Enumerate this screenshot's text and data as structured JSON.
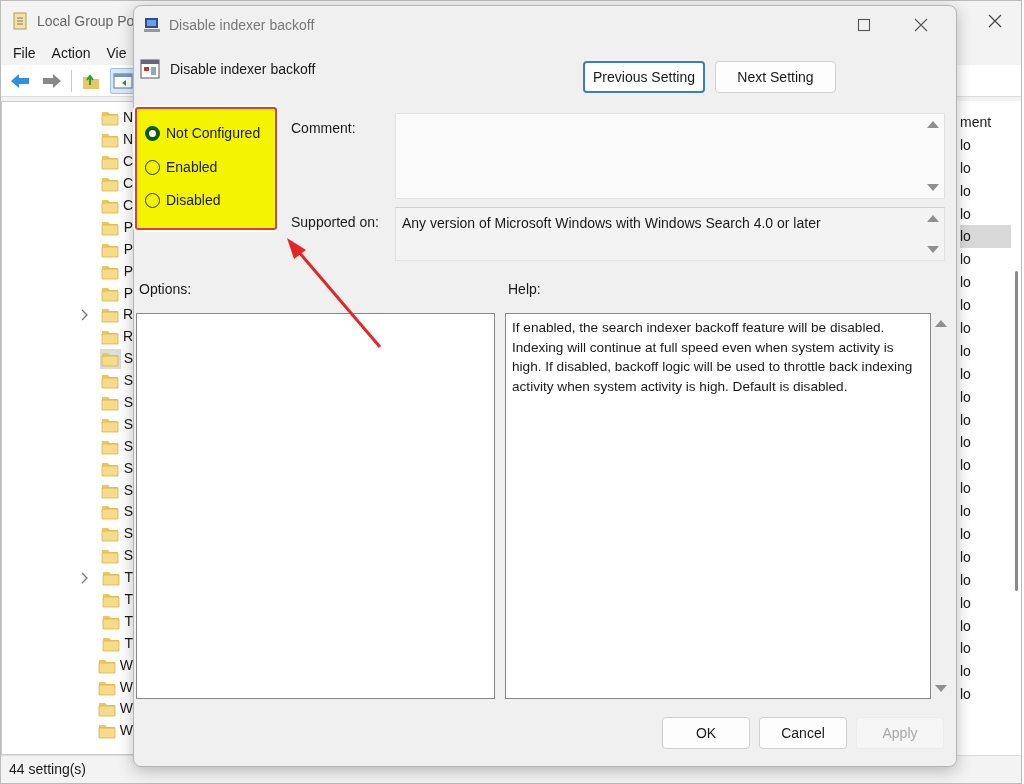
{
  "background_window": {
    "title": "Local Group Po",
    "menu": [
      "File",
      "Action",
      "Vie"
    ],
    "tree": [
      {
        "label": "N",
        "expandable": false,
        "selected": false
      },
      {
        "label": "N",
        "expandable": false,
        "selected": false
      },
      {
        "label": "C",
        "expandable": false,
        "selected": false
      },
      {
        "label": "C",
        "expandable": false,
        "selected": false
      },
      {
        "label": "C",
        "expandable": false,
        "selected": false
      },
      {
        "label": "P",
        "expandable": false,
        "selected": false
      },
      {
        "label": "P",
        "expandable": false,
        "selected": false
      },
      {
        "label": "P",
        "expandable": false,
        "selected": false
      },
      {
        "label": "P",
        "expandable": false,
        "selected": false
      },
      {
        "label": "R",
        "expandable": true,
        "selected": false
      },
      {
        "label": "R",
        "expandable": false,
        "selected": false
      },
      {
        "label": "S",
        "expandable": false,
        "selected": true
      },
      {
        "label": "S",
        "expandable": false,
        "selected": false
      },
      {
        "label": "S",
        "expandable": false,
        "selected": false
      },
      {
        "label": "S",
        "expandable": false,
        "selected": false
      },
      {
        "label": "S",
        "expandable": false,
        "selected": false
      },
      {
        "label": "S",
        "expandable": false,
        "selected": false
      },
      {
        "label": "S",
        "expandable": false,
        "selected": false
      },
      {
        "label": "S",
        "expandable": false,
        "selected": false
      },
      {
        "label": "S",
        "expandable": false,
        "selected": false
      },
      {
        "label": "S",
        "expandable": false,
        "selected": false
      },
      {
        "label": "T",
        "expandable": true,
        "selected": false
      },
      {
        "label": "T",
        "expandable": false,
        "selected": false
      },
      {
        "label": "T",
        "expandable": false,
        "selected": false
      },
      {
        "label": "T",
        "expandable": false,
        "selected": false
      },
      {
        "label": "W",
        "expandable": false,
        "selected": false
      },
      {
        "label": "W",
        "expandable": false,
        "selected": false
      },
      {
        "label": "W",
        "expandable": false,
        "selected": false
      },
      {
        "label": "W",
        "expandable": false,
        "selected": false
      }
    ],
    "column_header": "ment",
    "column_cells": [
      {
        "text": "lo",
        "selected": false
      },
      {
        "text": "lo",
        "selected": false
      },
      {
        "text": "lo",
        "selected": false
      },
      {
        "text": "lo",
        "selected": false
      },
      {
        "text": "lo",
        "selected": true
      },
      {
        "text": "lo",
        "selected": false
      },
      {
        "text": "lo",
        "selected": false
      },
      {
        "text": "lo",
        "selected": false
      },
      {
        "text": "lo",
        "selected": false
      },
      {
        "text": "lo",
        "selected": false
      },
      {
        "text": "lo",
        "selected": false
      },
      {
        "text": "lo",
        "selected": false
      },
      {
        "text": "lo",
        "selected": false
      },
      {
        "text": "lo",
        "selected": false
      },
      {
        "text": "lo",
        "selected": false
      },
      {
        "text": "lo",
        "selected": false
      },
      {
        "text": "lo",
        "selected": false
      },
      {
        "text": "lo",
        "selected": false
      },
      {
        "text": "lo",
        "selected": false
      },
      {
        "text": "lo",
        "selected": false
      },
      {
        "text": "lo",
        "selected": false
      },
      {
        "text": "lo",
        "selected": false
      },
      {
        "text": "lo",
        "selected": false
      },
      {
        "text": "lo",
        "selected": false
      },
      {
        "text": "lo",
        "selected": false
      }
    ],
    "status_bar": "44 setting(s)"
  },
  "dialog": {
    "title": "Disable indexer backoff",
    "setting_name": "Disable indexer backoff",
    "nav_buttons": [
      {
        "label": "Previous Setting",
        "focused": true
      },
      {
        "label": "Next Setting",
        "focused": false
      }
    ],
    "states": [
      {
        "label": "Not Configured",
        "selected": true
      },
      {
        "label": "Enabled",
        "selected": false
      },
      {
        "label": "Disabled",
        "selected": false
      }
    ],
    "comment_label": "Comment:",
    "supported_label": "Supported on:",
    "supported_text": "Any version of Microsoft Windows with Windows Search 4.0 or later",
    "options_label": "Options:",
    "help_label": "Help:",
    "help_text": "If enabled, the search indexer backoff feature will be disabled. Indexing will continue at full speed even when system activity is high. If disabled, backoff logic will be used to throttle back indexing activity when system activity is high. Default is disabled.",
    "buttons": [
      {
        "label": "OK",
        "disabled": false
      },
      {
        "label": "Cancel",
        "disabled": false
      },
      {
        "label": "Apply",
        "disabled": true
      }
    ]
  }
}
